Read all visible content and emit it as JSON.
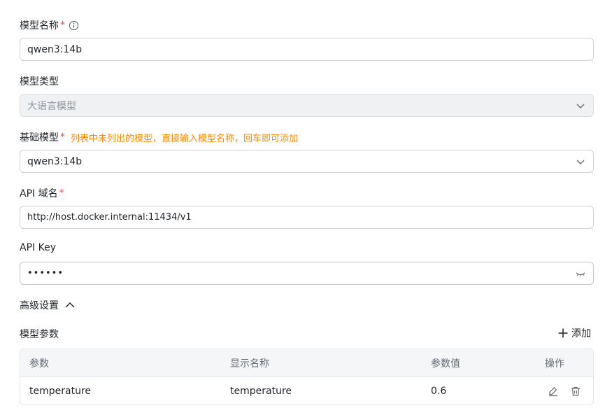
{
  "form": {
    "model_name": {
      "label": "模型名称",
      "required": "*",
      "value": "qwen3:14b"
    },
    "model_type": {
      "label": "模型类型",
      "value": "大语言模型"
    },
    "base_model": {
      "label": "基础模型",
      "required": "*",
      "hint": "列表中未列出的模型，直接输入模型名称，回车即可添加",
      "value": "qwen3:14b"
    },
    "api_domain": {
      "label": "API 域名",
      "required": "*",
      "value": "http://host.docker.internal:11434/v1"
    },
    "api_key": {
      "label": "API Key",
      "value": "••••••"
    }
  },
  "advanced": {
    "label": "高级设置"
  },
  "params": {
    "title": "模型参数",
    "add_label": "添加",
    "columns": [
      "参数",
      "显示名称",
      "参数值",
      "操作"
    ],
    "rows": [
      {
        "param": "temperature",
        "display_name": "temperature",
        "value": "0.6"
      }
    ]
  },
  "colors": {
    "required": "#f54a45",
    "hint": "#ff8800"
  },
  "icons": [
    "info-icon",
    "chevron-down-icon",
    "eye-closed-icon",
    "chevron-up-icon",
    "plus-icon",
    "edit-icon",
    "trash-icon"
  ]
}
